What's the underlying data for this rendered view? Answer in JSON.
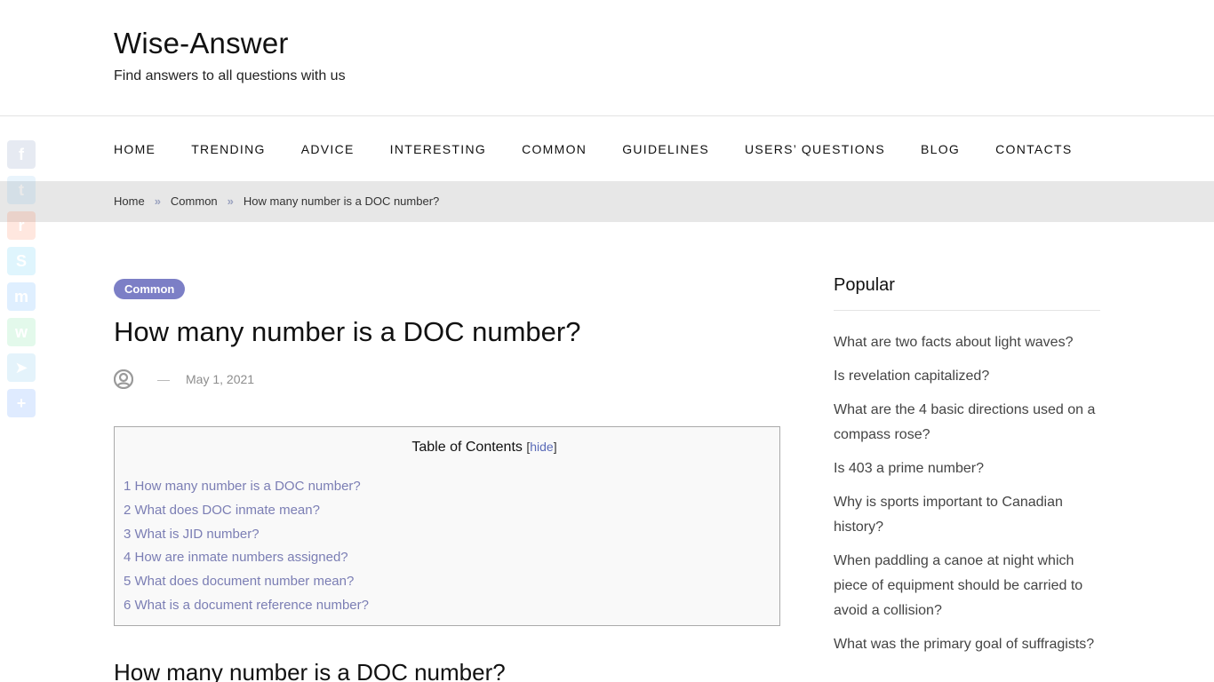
{
  "site": {
    "title": "Wise-Answer",
    "tagline": "Find answers to all questions with us"
  },
  "nav": {
    "items": [
      {
        "label": "HOME"
      },
      {
        "label": "TRENDING"
      },
      {
        "label": "ADVICE"
      },
      {
        "label": "INTERESTING"
      },
      {
        "label": "COMMON"
      },
      {
        "label": "GUIDELINES"
      },
      {
        "label": "USERS’ QUESTIONS"
      },
      {
        "label": "BLOG"
      },
      {
        "label": "CONTACTS"
      }
    ]
  },
  "breadcrumb": {
    "items": [
      {
        "label": "Home"
      },
      {
        "label": "Common"
      },
      {
        "label": "How many number is a DOC number?"
      }
    ],
    "separator": "»"
  },
  "share": {
    "buttons": [
      {
        "name": "facebook",
        "glyph": "f",
        "color": "#3b5998"
      },
      {
        "name": "twitter",
        "glyph": "t",
        "color": "#55acee"
      },
      {
        "name": "reddit",
        "glyph": "r",
        "color": "#ff4500"
      },
      {
        "name": "skype",
        "glyph": "S",
        "color": "#00aff0"
      },
      {
        "name": "messenger",
        "glyph": "m",
        "color": "#0084ff"
      },
      {
        "name": "whatsapp",
        "glyph": "w",
        "color": "#25d366"
      },
      {
        "name": "telegram",
        "glyph": "➤",
        "color": "#2ca5e0"
      },
      {
        "name": "more",
        "glyph": "+",
        "color": "#0166ff"
      }
    ]
  },
  "post": {
    "category": "Common",
    "title": "How many number is a DOC number?",
    "meta_dash": "—",
    "date": "May 1, 2021"
  },
  "toc": {
    "title": "Table of Contents",
    "toggle_open": "[",
    "toggle_label": "hide",
    "toggle_close": "]",
    "items": [
      "1 How many number is a DOC number?",
      "2 What does DOC inmate mean?",
      "3 What is JID number?",
      "4 How are inmate numbers assigned?",
      "5 What does document number mean?",
      "6 What is a document reference number?"
    ]
  },
  "section": {
    "heading": "How many number is a DOC number?"
  },
  "sidebar": {
    "widget_title": "Popular",
    "items": [
      "What are two facts about light waves?",
      "Is revelation capitalized?",
      "What are the 4 basic directions used on a compass rose?",
      "Is 403 a prime number?",
      "Why is sports important to Canadian history?",
      "When paddling a canoe at night which piece of equipment should be carried to avoid a collision?",
      "What was the primary goal of suffragists?"
    ]
  },
  "colors": {
    "accent": "#7c7fc6",
    "toc_link": "#7b7eb4",
    "breadcrumb_bg": "#e7e7e7"
  }
}
